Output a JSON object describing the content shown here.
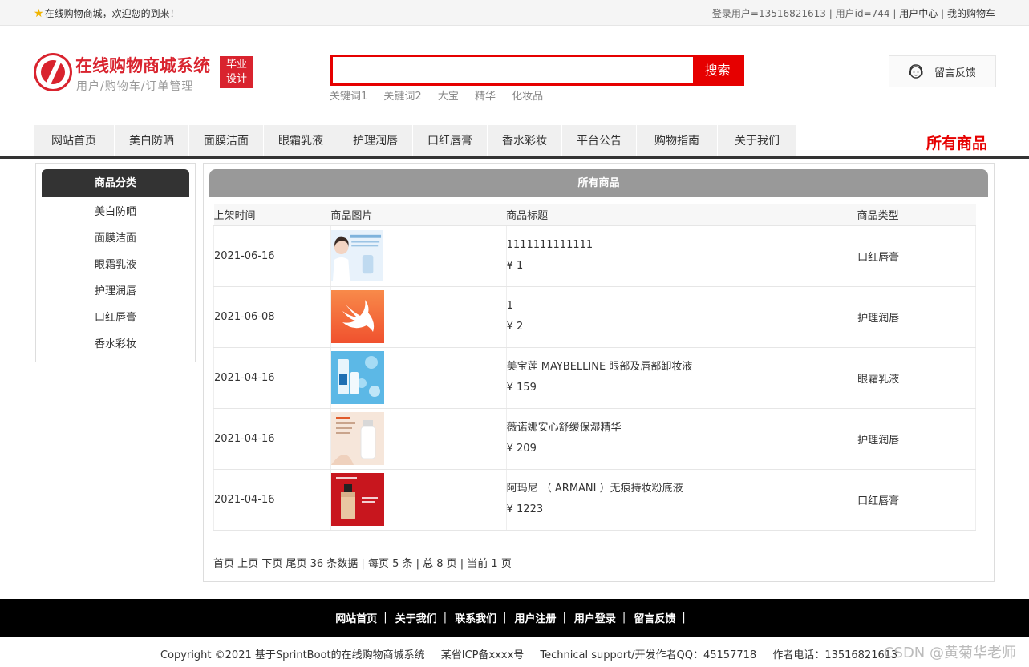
{
  "topbar": {
    "welcome": "在线购物商城，欢迎您的到来！",
    "login_user": "登录用户=13516821613",
    "user_id": "用户id=744",
    "user_center": "用户中心",
    "cart": "我的购物车",
    "sep": "|"
  },
  "header": {
    "site_name": "在线购物商城系统",
    "subtitle": "用户/购物车/订单管理",
    "badge_line1": "毕业",
    "badge_line2": "设计",
    "search_value": "",
    "search_button": "搜索",
    "keywords": [
      "关键词1",
      "关键词2",
      "大宝",
      "精华",
      "化妆品"
    ],
    "feedback": "留言反馈"
  },
  "nav": {
    "items": [
      "网站首页",
      "美白防晒",
      "面膜洁面",
      "眼霜乳液",
      "护理润唇",
      "口红唇膏",
      "香水彩妆",
      "平台公告",
      "购物指南",
      "关于我们"
    ],
    "current": "所有商品"
  },
  "sidebar": {
    "title": "商品分类",
    "items": [
      "美白防晒",
      "面膜洁面",
      "眼霜乳液",
      "护理润唇",
      "口红唇膏",
      "香水彩妆"
    ]
  },
  "main": {
    "title": "所有商品",
    "columns": [
      "上架时间",
      "商品图片",
      "商品标题",
      "商品类型"
    ],
    "rows": [
      {
        "date": "2021-06-16",
        "title": "1111111111111",
        "price": "¥ 1",
        "type": "口红唇膏"
      },
      {
        "date": "2021-06-08",
        "title": "1",
        "price": "¥ 2",
        "type": "护理润唇"
      },
      {
        "date": "2021-04-16",
        "title": "美宝莲 MAYBELLINE 眼部及唇部卸妆液",
        "price": "¥ 159",
        "type": "眼霜乳液"
      },
      {
        "date": "2021-04-16",
        "title": "薇诺娜安心舒缓保湿精华",
        "price": "¥ 209",
        "type": "护理润唇"
      },
      {
        "date": "2021-04-16",
        "title": "阿玛尼 （ ARMANI ）无痕持妆粉底液",
        "price": "¥ 1223",
        "type": "口红唇膏"
      }
    ],
    "pager": {
      "first": "首页",
      "prev": "上页",
      "next": "下页",
      "last": "尾页",
      "summary": "36 条数据 | 每页 5 条 | 总 8 页 | 当前 1 页"
    }
  },
  "footer": {
    "links": [
      "网站首页",
      "关于我们",
      "联系我们",
      "用户注册",
      "用户登录",
      "留言反馈"
    ],
    "sep": "|",
    "copyright": "Copyright ©2021 基于SprintBoot的在线购物商城系统",
    "icp": "某省ICP备xxxx号",
    "support": "Technical support/开发作者QQ：45157718",
    "phone": "作者电话：13516821613"
  },
  "watermark": "CSDN @黄菊华老师",
  "colors": {
    "accent": "#e60000",
    "brand": "#d9232e",
    "dark": "#333333"
  }
}
